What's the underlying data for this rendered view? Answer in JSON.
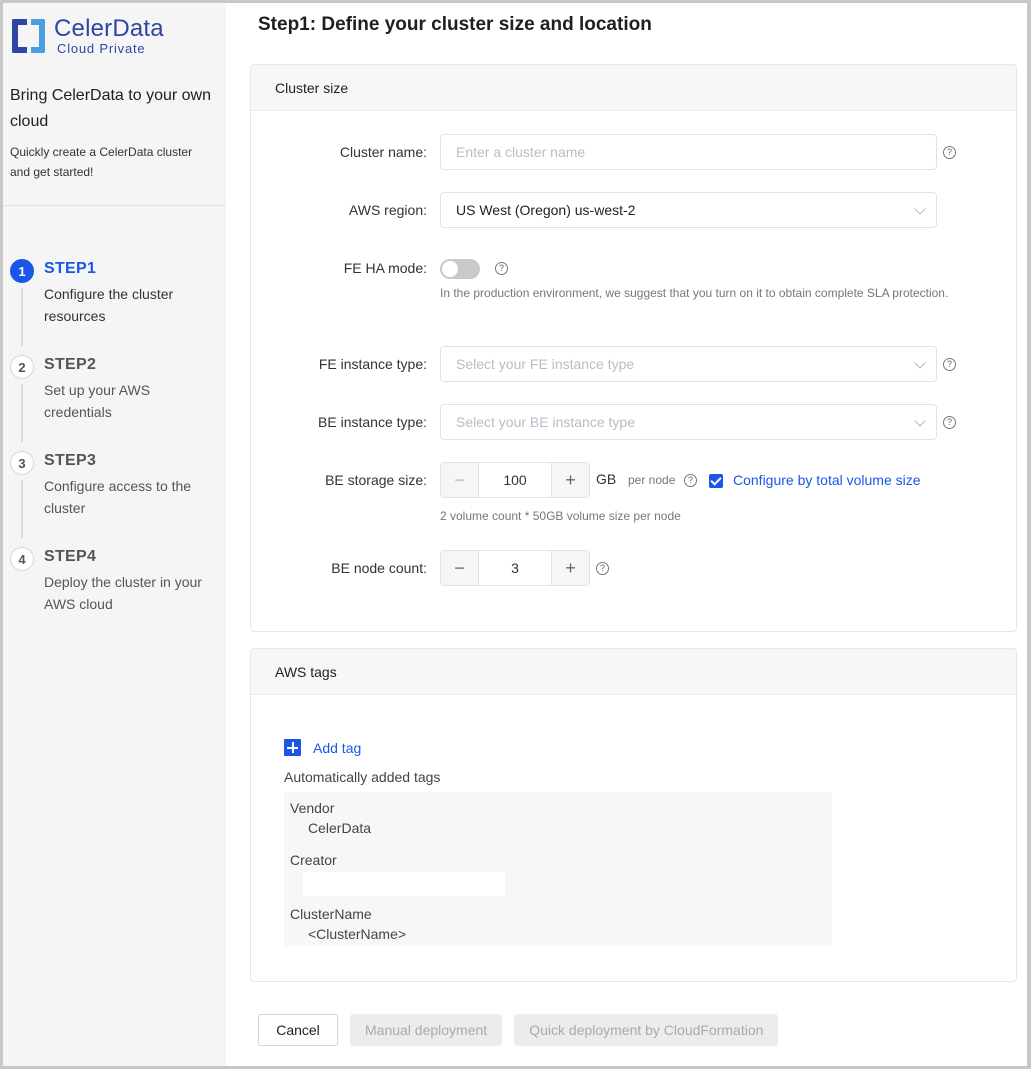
{
  "brand": {
    "title": "CelerData",
    "subtitle": "Cloud Private",
    "colors": {
      "primary": "#2c46a6",
      "secondary": "#4b9fe0"
    }
  },
  "sidebar": {
    "intro_title": "Bring CelerData to your own cloud",
    "intro_subtitle": "Quickly create a CelerData cluster and get started!",
    "steps": [
      {
        "number": "1",
        "title": "STEP1",
        "description": "Configure the cluster resources",
        "active": true
      },
      {
        "number": "2",
        "title": "STEP2",
        "description": "Set up your AWS credentials",
        "active": false
      },
      {
        "number": "3",
        "title": "STEP3",
        "description": "Configure access to the cluster",
        "active": false
      },
      {
        "number": "4",
        "title": "STEP4",
        "description": "Deploy the cluster in your AWS cloud",
        "active": false
      }
    ]
  },
  "page": {
    "title": "Step1: Define your cluster size and location",
    "accent_color": "#1a56e8"
  },
  "cluster_size": {
    "heading": "Cluster size",
    "cluster_name": {
      "label": "Cluster name:",
      "value": "",
      "placeholder": "Enter a cluster name",
      "help_icon": "question-circle-icon"
    },
    "aws_region": {
      "label": "AWS region:",
      "value": "US West (Oregon) us-west-2"
    },
    "fe_ha_mode": {
      "label": "FE HA mode:",
      "enabled": false,
      "hint": "In the production environment, we suggest that you turn on it to obtain complete SLA protection."
    },
    "fe_instance_type": {
      "label": "FE instance type:",
      "value": "",
      "placeholder": "Select your FE instance type"
    },
    "be_instance_type": {
      "label": "BE instance type:",
      "value": "",
      "placeholder": "Select your BE instance type"
    },
    "be_storage_size": {
      "label": "BE storage size:",
      "value": "100",
      "unit": "GB",
      "per_node": "per node",
      "configure_by_total": {
        "label": "Configure by total volume size",
        "checked": true
      },
      "hint": "2 volume count * 50GB volume size per node"
    },
    "be_node_count": {
      "label": "BE node count:",
      "value": "3"
    },
    "minus": "−",
    "plus": "+",
    "help": "?"
  },
  "aws_tags": {
    "heading": "AWS tags",
    "add_tag": "Add tag",
    "auto_label": "Automatically added tags",
    "tags": [
      {
        "key": "Vendor",
        "value": "CelerData"
      },
      {
        "key": "Creator",
        "value": ""
      },
      {
        "key": "ClusterName",
        "value": "<ClusterName>"
      }
    ]
  },
  "footer": {
    "cancel": "Cancel",
    "manual": "Manual deployment",
    "quick": "Quick deployment by CloudFormation"
  }
}
